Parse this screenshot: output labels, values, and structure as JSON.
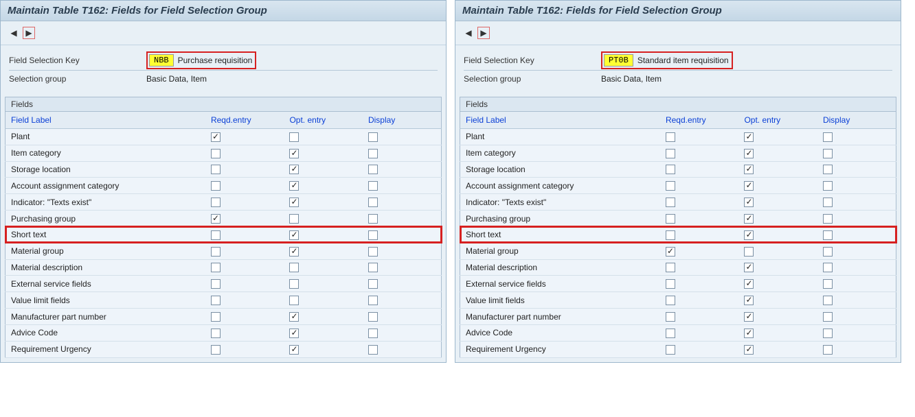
{
  "panels": [
    {
      "title": "Maintain Table T162: Fields for Field Selection Group",
      "fieldSelectionKey": {
        "label": "Field Selection Key",
        "code": "NBB",
        "desc": "Purchase requisition"
      },
      "selectionGroup": {
        "label": "Selection group",
        "value": "Basic Data, Item"
      },
      "gridTitle": "Fields",
      "columns": {
        "label": "Field Label",
        "reqd": "Reqd.entry",
        "opt": "Opt. entry",
        "disp": "Display"
      },
      "rows": [
        {
          "label": "Plant",
          "reqd": true,
          "opt": false,
          "disp": false,
          "hl": false
        },
        {
          "label": "Item category",
          "reqd": false,
          "opt": true,
          "disp": false,
          "hl": false
        },
        {
          "label": "Storage location",
          "reqd": false,
          "opt": true,
          "disp": false,
          "hl": false
        },
        {
          "label": "Account assignment category",
          "reqd": false,
          "opt": true,
          "disp": false,
          "hl": false
        },
        {
          "label": "Indicator: \"Texts exist\"",
          "reqd": false,
          "opt": true,
          "disp": false,
          "hl": false
        },
        {
          "label": "Purchasing group",
          "reqd": true,
          "opt": false,
          "disp": false,
          "hl": false
        },
        {
          "label": "Short text",
          "reqd": false,
          "opt": true,
          "disp": false,
          "hl": true
        },
        {
          "label": "Material group",
          "reqd": false,
          "opt": true,
          "disp": false,
          "hl": false
        },
        {
          "label": "Material description",
          "reqd": false,
          "opt": false,
          "disp": false,
          "hl": false
        },
        {
          "label": "External service fields",
          "reqd": false,
          "opt": false,
          "disp": false,
          "hl": false
        },
        {
          "label": "Value limit fields",
          "reqd": false,
          "opt": false,
          "disp": false,
          "hl": false
        },
        {
          "label": "Manufacturer part number",
          "reqd": false,
          "opt": true,
          "disp": false,
          "hl": false
        },
        {
          "label": "Advice Code",
          "reqd": false,
          "opt": true,
          "disp": false,
          "hl": false
        },
        {
          "label": "Requirement Urgency",
          "reqd": false,
          "opt": true,
          "disp": false,
          "hl": false
        }
      ]
    },
    {
      "title": "Maintain Table T162: Fields for Field Selection Group",
      "fieldSelectionKey": {
        "label": "Field Selection Key",
        "code": "PT0B",
        "desc": "Standard item requisition"
      },
      "selectionGroup": {
        "label": "Selection group",
        "value": "Basic Data, Item"
      },
      "gridTitle": "Fields",
      "columns": {
        "label": "Field Label",
        "reqd": "Reqd.entry",
        "opt": "Opt. entry",
        "disp": "Display"
      },
      "rows": [
        {
          "label": "Plant",
          "reqd": false,
          "opt": true,
          "disp": false,
          "hl": false
        },
        {
          "label": "Item category",
          "reqd": false,
          "opt": true,
          "disp": false,
          "hl": false
        },
        {
          "label": "Storage location",
          "reqd": false,
          "opt": true,
          "disp": false,
          "hl": false
        },
        {
          "label": "Account assignment category",
          "reqd": false,
          "opt": true,
          "disp": false,
          "hl": false
        },
        {
          "label": "Indicator: \"Texts exist\"",
          "reqd": false,
          "opt": true,
          "disp": false,
          "hl": false
        },
        {
          "label": "Purchasing group",
          "reqd": false,
          "opt": true,
          "disp": false,
          "hl": false
        },
        {
          "label": "Short text",
          "reqd": false,
          "opt": true,
          "disp": false,
          "hl": true
        },
        {
          "label": "Material group",
          "reqd": true,
          "opt": false,
          "disp": false,
          "hl": false
        },
        {
          "label": "Material description",
          "reqd": false,
          "opt": true,
          "disp": false,
          "hl": false
        },
        {
          "label": "External service fields",
          "reqd": false,
          "opt": true,
          "disp": false,
          "hl": false
        },
        {
          "label": "Value limit fields",
          "reqd": false,
          "opt": true,
          "disp": false,
          "hl": false
        },
        {
          "label": "Manufacturer part number",
          "reqd": false,
          "opt": true,
          "disp": false,
          "hl": false
        },
        {
          "label": "Advice Code",
          "reqd": false,
          "opt": true,
          "disp": false,
          "hl": false
        },
        {
          "label": "Requirement Urgency",
          "reqd": false,
          "opt": true,
          "disp": false,
          "hl": false
        }
      ]
    }
  ]
}
